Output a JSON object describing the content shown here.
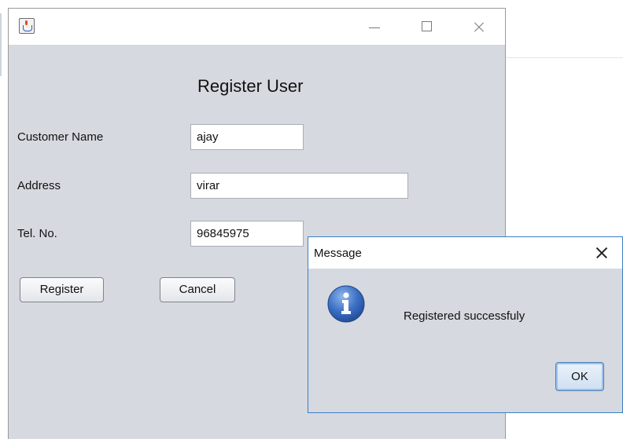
{
  "window": {
    "icon": "java-cup-icon",
    "controls": {
      "minimize": "minimize-icon",
      "maximize": "maximize-icon",
      "close": "close-icon"
    }
  },
  "form": {
    "heading": "Register User",
    "fields": [
      {
        "label": "Customer Name",
        "value": "ajay"
      },
      {
        "label": "Address",
        "value": "virar"
      },
      {
        "label": "Tel. No.",
        "value": "96845975"
      }
    ],
    "buttons": {
      "register": "Register",
      "cancel": "Cancel"
    }
  },
  "dialog": {
    "title": "Message",
    "icon": "info-icon",
    "message": "Registered successfuly",
    "ok_label": "OK",
    "accent": "#3c7fc1"
  },
  "colors": {
    "window_bg": "#d6d9df",
    "titlebar_bg": "#ffffff",
    "info_icon": "#2f5fb4"
  }
}
